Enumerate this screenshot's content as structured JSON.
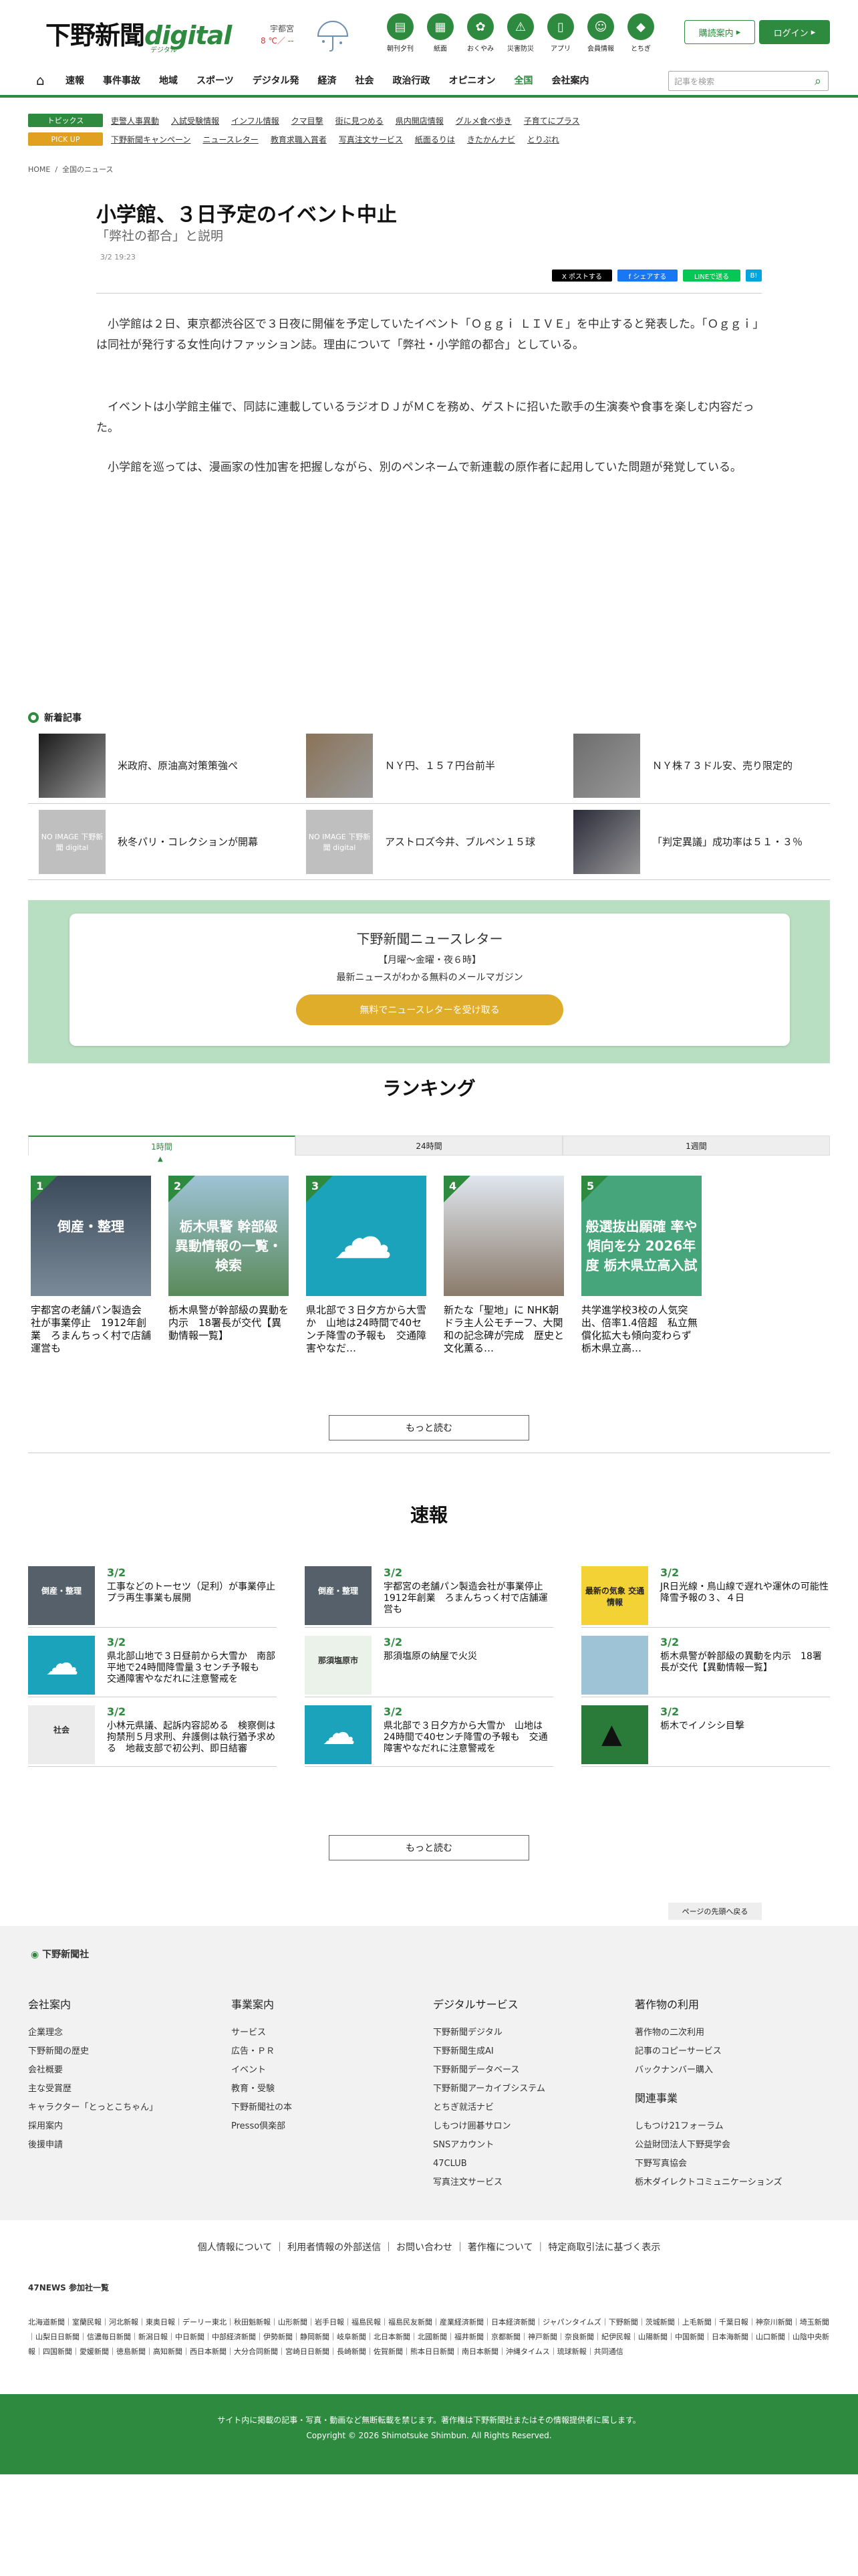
{
  "header": {
    "logo_main": "下野新聞",
    "logo_digital": "digital",
    "logo_sub": "デジタル",
    "weather_loc": "宇都宮",
    "weather_temp": "8 ℃／ --",
    "icons": [
      {
        "label": "朝刊夕刊",
        "glyph": "▤"
      },
      {
        "label": "紙面",
        "glyph": "▦"
      },
      {
        "label": "おくやみ",
        "glyph": "✿"
      },
      {
        "label": "災害防災",
        "glyph": "⚠"
      },
      {
        "label": "アプリ",
        "glyph": "▯"
      },
      {
        "label": "会員情報",
        "glyph": "☺"
      },
      {
        "label": "とちぎ",
        "glyph": "◆"
      }
    ],
    "subscribe": "購読案内",
    "login": "ログイン"
  },
  "nav": {
    "items": [
      "速報",
      "事件事故",
      "地域",
      "スポーツ",
      "デジタル発",
      "経済",
      "社会",
      "政治行政",
      "オピニオン",
      "全国",
      "会社案内"
    ],
    "active": "全国",
    "search_placeholder": "記事を検索"
  },
  "topics": {
    "pill1": "トピックス",
    "pill2": "PICK UP",
    "row1": [
      "吏警人事異動",
      "入試受験情報",
      "インフル情報",
      "クマ目撃",
      "街に見つめる",
      "県内開店情報",
      "グルメ食べ歩き",
      "子育てにプラス"
    ],
    "row2": [
      "下野新聞キャンペーン",
      "ニュースレター",
      "教育求職入賞者",
      "写真注文サービス",
      "紙面るりは",
      "きたかんナビ",
      "とりぷれ"
    ]
  },
  "breadcrumb": {
    "home": "HOME",
    "sep": "/",
    "current": "全国のニュース"
  },
  "article": {
    "title": "小学館、３日予定のイベント中止",
    "subtitle": "「弊社の都合」と説明",
    "date": "3/2 19:23",
    "share": [
      "X ポストする",
      "f シェアする",
      "LINEで送る",
      "B!"
    ],
    "paragraphs": [
      "小学館は２日、東京都渋谷区で３日夜に開催を予定していたイベント「Ｏｇｇｉ ＬＩＶＥ」を中止すると発表した。「Ｏｇｇｉ」は同社が発行する女性向けファッション誌。理由について「弊社・小学館の都合」としている。",
      "イベントは小学館主催で、同誌に連載しているラジオＤＪがＭＣを務め、ゲストに招いた歌手の生演奏や食事を楽しむ内容だった。",
      "小学館を巡っては、漫画家の性加害を把握しながら、別のペンネームで新連載の原作者に起用していた問題が発覚している。"
    ]
  },
  "latest": {
    "heading": "新着記事",
    "noimage": "NO IMAGE 下野新聞 digital",
    "items": [
      "米政府、原油高対策策強ぺ",
      "ＮＹ円、１５７円台前半",
      "ＮＹ株７３ドル安、売り限定的",
      "秋冬パリ・コレクションが開幕",
      "アストロズ今井、ブルペン１５球",
      "「判定異議」成功率は５１・３％"
    ]
  },
  "newsletter": {
    "title": "下野新聞ニュースレター",
    "sched": "【月曜〜金曜・夜６時】",
    "desc": "最新ニュースがわかる無料のメールマガジン",
    "button": "無料でニュースレターを受け取る"
  },
  "ranking": {
    "heading": "ランキング",
    "tabs": [
      "1時間",
      "24時間",
      "1週間"
    ],
    "items": [
      {
        "no": "1",
        "text": "宇都宮の老舗パン製造会社が事業停止　1912年創業　ろまんちっく村で店舗運営も",
        "img": "倒産・整理"
      },
      {
        "no": "2",
        "text": "栃木県警が幹部級の異動を内示　18署長が交代【異動情報一覧】",
        "img": "栃木県警 幹部級 異動情報の一覧・検索"
      },
      {
        "no": "3",
        "text": "県北部で３日夕方から大雪か　山地は24時間で40センチ降雪の予報も　交通障害やなだ…",
        "img": ""
      },
      {
        "no": "4",
        "text": "新たな「聖地」に NHK朝ドラ主人公モチーフ、大関和の記念碑が完成　歴史と文化薫る…",
        "img": ""
      },
      {
        "no": "5",
        "text": "共学進学校3校の人気突出、倍率1.4倍超　私立無償化拡大も傾向変わらず　栃木県立高…",
        "img": "般選抜出願確 率や傾向を分 2026年度 栃木県立高入試"
      }
    ],
    "more": "もっと読む"
  },
  "sokuho": {
    "heading": "速報",
    "items": [
      {
        "date": "3/2",
        "text": "工事などのトーセツ（足利）が事業停止　プラ再生事業も展開",
        "img": "倒産・整理"
      },
      {
        "date": "3/2",
        "text": "宇都宮の老舗パン製造会社が事業停止　1912年創業　ろまんちっく村で店舗運営も",
        "img": "倒産・整理"
      },
      {
        "date": "3/2",
        "text": "JR日光線・鳥山線で遅れや運休の可能性　降雪予報の３、４日",
        "img": "最新の気象 交通情報"
      },
      {
        "date": "3/2",
        "text": "県北部山地で３日昼前から大雪か　南部平地で24時間降雪量３センチ予報も　交通障害やなだれに注意警戒を",
        "img": ""
      },
      {
        "date": "3/2",
        "text": "那須塩原の納屋で火災",
        "img": "那須塩原市"
      },
      {
        "date": "3/2",
        "text": "栃木県警が幹部級の異動を内示　18署長が交代【異動情報一覧】",
        "img": ""
      },
      {
        "date": "3/2",
        "text": "小林元県議、起訴内容認める　検察側は拘禁刑５月求刑、弁護側は執行猶予求める　地裁支部で初公判、即日結審",
        "img": "社会"
      },
      {
        "date": "3/2",
        "text": "県北部で３日夕方から大雪か　山地は24時間で40センチ降雪の予報も　交通障害やなだれに注意警戒を",
        "img": ""
      },
      {
        "date": "3/2",
        "text": "栃木でイノシシ目撃",
        "img": ""
      }
    ],
    "more": "もっと読む"
  },
  "footer": {
    "toplink": "ページの先頭へ戻る",
    "logo": "下野新聞社",
    "cols": [
      {
        "title": "会社案内",
        "links": [
          "企業理念",
          "下野新聞の歴史",
          "会社概要",
          "主な受賞歴",
          "キャラクター「とっとこちゃん」",
          "採用案内",
          "後援申請"
        ]
      },
      {
        "title": "事業案内",
        "links": [
          "サービス",
          "広告・ＰＲ",
          "イベント",
          "教育・受験",
          "下野新聞社の本",
          "Presso倶楽部"
        ]
      },
      {
        "title": "デジタルサービス",
        "links": [
          "下野新聞デジタル",
          "下野新聞生成AI",
          "下野新聞データベース",
          "下野新聞アーカイブシステム",
          "とちぎ就活ナビ",
          "しもつけ囲碁サロン",
          "SNSアカウント",
          "47CLUB",
          "写真注文サービス"
        ]
      },
      {
        "title": "著作物の利用",
        "links": [
          "著作物の二次利用",
          "記事のコピーサービス",
          "バックナンバー購入"
        ],
        "title2": "関連事業",
        "links2": [
          "しもつけ21フォーラム",
          "公益財団法人下野奨学会",
          "下野写真協会",
          "栃木ダイレクトコミュニケーションズ"
        ]
      }
    ],
    "links": "個人情報について ｜ 利用者情報の外部送信 ｜ お問い合わせ ｜ 著作権について ｜ 特定商取引法に基づく表示",
    "n47_title": "47NEWS 参加社一覧",
    "n47_list": "北海道新聞｜室蘭民報｜河北新報｜東奥日報｜デーリー東北｜秋田魁新報｜山形新聞｜岩手日報｜福島民報｜福島民友新聞｜産業経済新聞｜日本経済新聞｜ジャパンタイムズ｜下野新聞｜茨城新聞｜上毛新聞｜千葉日報｜神奈川新聞｜埼玉新聞｜山梨日日新聞｜信濃毎日新聞｜新潟日報｜中日新聞｜中部経済新聞｜伊勢新聞｜静岡新聞｜岐阜新聞｜北日本新聞｜北國新聞｜福井新聞｜京都新聞｜神戸新聞｜奈良新聞｜紀伊民報｜山陽新聞｜中国新聞｜日本海新聞｜山口新聞｜山陰中央新報｜四国新聞｜愛媛新聞｜徳島新聞｜高知新聞｜西日本新聞｜大分合同新聞｜宮崎日日新聞｜長崎新聞｜佐賀新聞｜熊本日日新聞｜南日本新聞｜沖縄タイムス｜琉球新報｜共同通信",
    "copy1": "サイト内に掲載の記事・写真・動画など無断転載を禁じます。著作権は下野新聞社またはその情報提供者に属します。",
    "copy2": "Copyright © 2026 Shimotsuke Shimbun. All Rights Reserved."
  },
  "colors": {
    "green": "#2d8a3e",
    "orange": "#e0a020",
    "gold": "#e0ad2b"
  }
}
